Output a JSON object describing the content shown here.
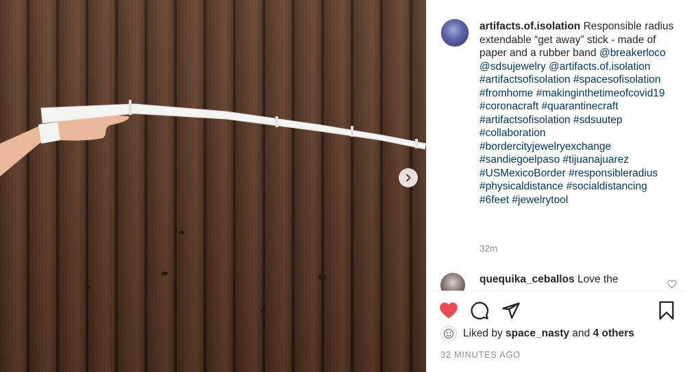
{
  "post": {
    "author": "artifacts.of.isolation",
    "caption_text": "Responsible radius extendable “get away” stick - made of paper and a rubber band",
    "mentions": [
      "@breakerloco",
      "@sdsujewelry",
      "@artifacts.of.isolation"
    ],
    "hashtags": [
      "#artifactsofisolation",
      "#spacesofisolation",
      "#fromhome",
      "#makinginthetimeofcovid19",
      "#coronacraft",
      "#quarantinecraft",
      "#artifactsofisolation",
      "#sdsuutep",
      "#collaboration",
      "#bordercityjewelryexchange",
      "#sandiegoelpaso",
      "#tijuanajuarez",
      "#USMexicoBorder",
      "#responsibleradius",
      "#physicaldistance",
      "#socialdistancing",
      "#6feet",
      "#jewelrytool"
    ],
    "caption_time": "32m"
  },
  "comment": {
    "author": "quequika_ceballos",
    "text": "Love the"
  },
  "likes": {
    "prefix": "Liked by",
    "liker": "space_nasty",
    "conjunction": "and",
    "others": "4 others"
  },
  "timestamp": "32 MINUTES AGO",
  "icons": {
    "like": "heart-filled-icon",
    "comment": "comment-bubble-icon",
    "share": "paper-plane-icon",
    "save": "bookmark-icon",
    "next": "chevron-right-icon",
    "comment_like": "heart-outline-icon"
  },
  "colors": {
    "like_red": "#ed4956",
    "hashtag_blue": "#00376b",
    "muted_gray": "#8e8e8e",
    "text": "#262626"
  }
}
